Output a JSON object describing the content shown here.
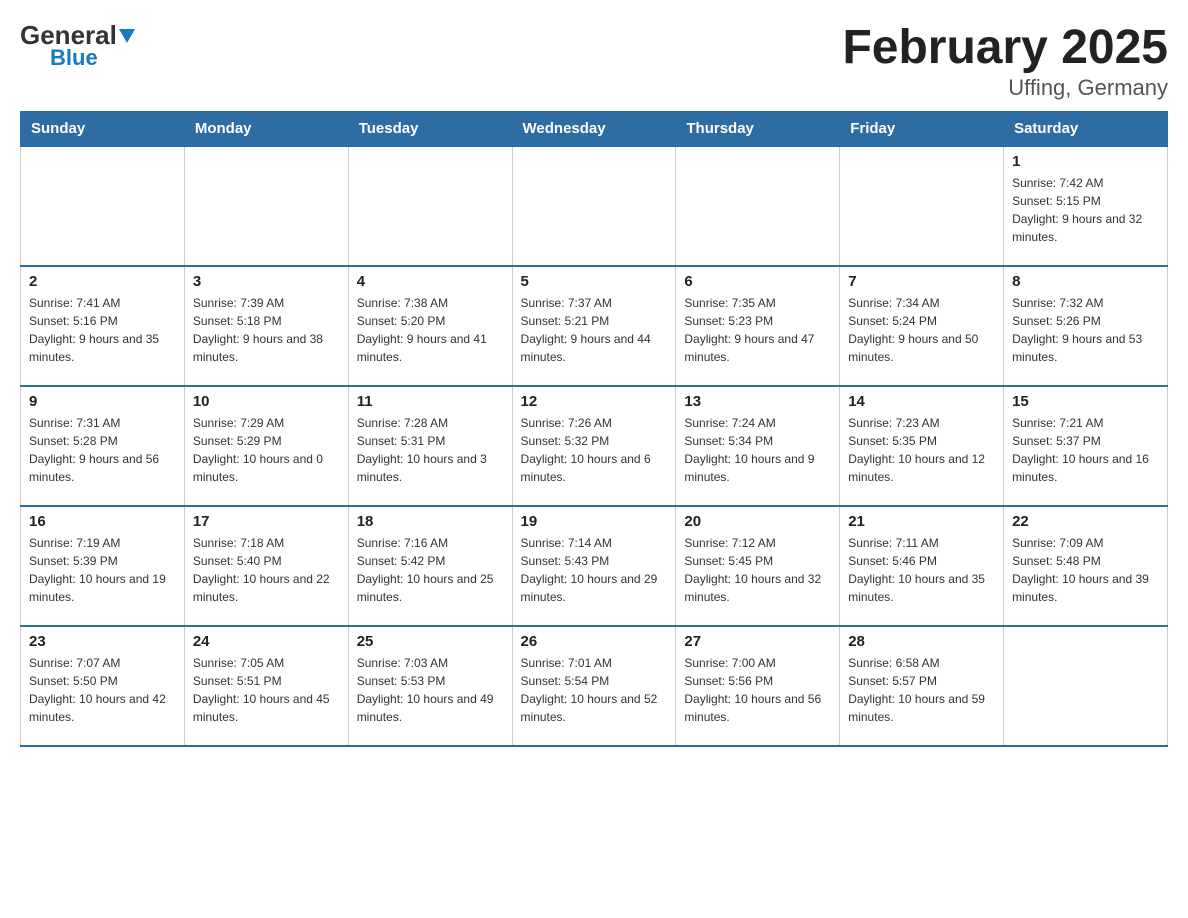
{
  "header": {
    "logo_general": "General",
    "logo_blue": "Blue",
    "title": "February 2025",
    "subtitle": "Uffing, Germany"
  },
  "days_of_week": [
    "Sunday",
    "Monday",
    "Tuesday",
    "Wednesday",
    "Thursday",
    "Friday",
    "Saturday"
  ],
  "weeks": [
    [
      {
        "day": "",
        "info": ""
      },
      {
        "day": "",
        "info": ""
      },
      {
        "day": "",
        "info": ""
      },
      {
        "day": "",
        "info": ""
      },
      {
        "day": "",
        "info": ""
      },
      {
        "day": "",
        "info": ""
      },
      {
        "day": "1",
        "info": "Sunrise: 7:42 AM\nSunset: 5:15 PM\nDaylight: 9 hours and 32 minutes."
      }
    ],
    [
      {
        "day": "2",
        "info": "Sunrise: 7:41 AM\nSunset: 5:16 PM\nDaylight: 9 hours and 35 minutes."
      },
      {
        "day": "3",
        "info": "Sunrise: 7:39 AM\nSunset: 5:18 PM\nDaylight: 9 hours and 38 minutes."
      },
      {
        "day": "4",
        "info": "Sunrise: 7:38 AM\nSunset: 5:20 PM\nDaylight: 9 hours and 41 minutes."
      },
      {
        "day": "5",
        "info": "Sunrise: 7:37 AM\nSunset: 5:21 PM\nDaylight: 9 hours and 44 minutes."
      },
      {
        "day": "6",
        "info": "Sunrise: 7:35 AM\nSunset: 5:23 PM\nDaylight: 9 hours and 47 minutes."
      },
      {
        "day": "7",
        "info": "Sunrise: 7:34 AM\nSunset: 5:24 PM\nDaylight: 9 hours and 50 minutes."
      },
      {
        "day": "8",
        "info": "Sunrise: 7:32 AM\nSunset: 5:26 PM\nDaylight: 9 hours and 53 minutes."
      }
    ],
    [
      {
        "day": "9",
        "info": "Sunrise: 7:31 AM\nSunset: 5:28 PM\nDaylight: 9 hours and 56 minutes."
      },
      {
        "day": "10",
        "info": "Sunrise: 7:29 AM\nSunset: 5:29 PM\nDaylight: 10 hours and 0 minutes."
      },
      {
        "day": "11",
        "info": "Sunrise: 7:28 AM\nSunset: 5:31 PM\nDaylight: 10 hours and 3 minutes."
      },
      {
        "day": "12",
        "info": "Sunrise: 7:26 AM\nSunset: 5:32 PM\nDaylight: 10 hours and 6 minutes."
      },
      {
        "day": "13",
        "info": "Sunrise: 7:24 AM\nSunset: 5:34 PM\nDaylight: 10 hours and 9 minutes."
      },
      {
        "day": "14",
        "info": "Sunrise: 7:23 AM\nSunset: 5:35 PM\nDaylight: 10 hours and 12 minutes."
      },
      {
        "day": "15",
        "info": "Sunrise: 7:21 AM\nSunset: 5:37 PM\nDaylight: 10 hours and 16 minutes."
      }
    ],
    [
      {
        "day": "16",
        "info": "Sunrise: 7:19 AM\nSunset: 5:39 PM\nDaylight: 10 hours and 19 minutes."
      },
      {
        "day": "17",
        "info": "Sunrise: 7:18 AM\nSunset: 5:40 PM\nDaylight: 10 hours and 22 minutes."
      },
      {
        "day": "18",
        "info": "Sunrise: 7:16 AM\nSunset: 5:42 PM\nDaylight: 10 hours and 25 minutes."
      },
      {
        "day": "19",
        "info": "Sunrise: 7:14 AM\nSunset: 5:43 PM\nDaylight: 10 hours and 29 minutes."
      },
      {
        "day": "20",
        "info": "Sunrise: 7:12 AM\nSunset: 5:45 PM\nDaylight: 10 hours and 32 minutes."
      },
      {
        "day": "21",
        "info": "Sunrise: 7:11 AM\nSunset: 5:46 PM\nDaylight: 10 hours and 35 minutes."
      },
      {
        "day": "22",
        "info": "Sunrise: 7:09 AM\nSunset: 5:48 PM\nDaylight: 10 hours and 39 minutes."
      }
    ],
    [
      {
        "day": "23",
        "info": "Sunrise: 7:07 AM\nSunset: 5:50 PM\nDaylight: 10 hours and 42 minutes."
      },
      {
        "day": "24",
        "info": "Sunrise: 7:05 AM\nSunset: 5:51 PM\nDaylight: 10 hours and 45 minutes."
      },
      {
        "day": "25",
        "info": "Sunrise: 7:03 AM\nSunset: 5:53 PM\nDaylight: 10 hours and 49 minutes."
      },
      {
        "day": "26",
        "info": "Sunrise: 7:01 AM\nSunset: 5:54 PM\nDaylight: 10 hours and 52 minutes."
      },
      {
        "day": "27",
        "info": "Sunrise: 7:00 AM\nSunset: 5:56 PM\nDaylight: 10 hours and 56 minutes."
      },
      {
        "day": "28",
        "info": "Sunrise: 6:58 AM\nSunset: 5:57 PM\nDaylight: 10 hours and 59 minutes."
      },
      {
        "day": "",
        "info": ""
      }
    ]
  ]
}
